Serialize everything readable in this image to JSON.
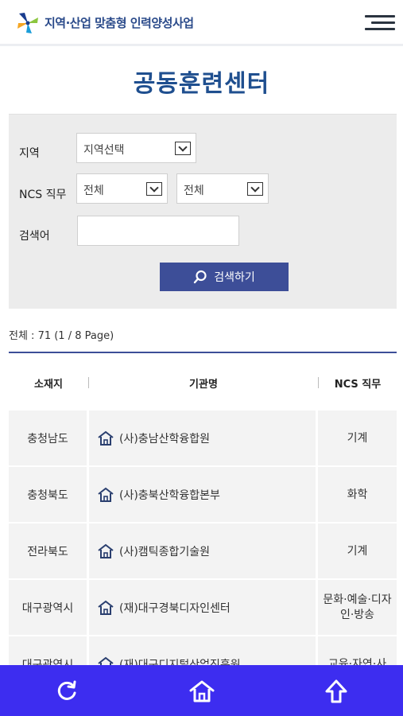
{
  "header": {
    "brand": "지역·산업 맞춤형 인력양성사업",
    "logo_icon": "pinwheel-logo-icon",
    "menu_icon": "hamburger-menu-icon"
  },
  "page_title": "공동훈련센터",
  "search": {
    "region_label": "지역",
    "region_value": "지역선택",
    "ncs_label": "NCS 직무",
    "ncs_value_1": "전체",
    "ncs_value_2": "전체",
    "keyword_label": "검색어",
    "keyword_value": "",
    "button_label": "검색하기",
    "button_icon": "search-icon"
  },
  "summary": "전체 : 71 (1 / 8 Page)",
  "table": {
    "headers": [
      "소재지",
      "기관명",
      "NCS 직무"
    ],
    "rows": [
      {
        "location": "충청남도",
        "name": "(사)충남산학융합원",
        "ncs": "기계"
      },
      {
        "location": "충청북도",
        "name": "(사)충북산학융합본부",
        "ncs": "화학"
      },
      {
        "location": "전라북도",
        "name": "(사)캠틱종합기술원",
        "ncs": "기계"
      },
      {
        "location": "대구광역시",
        "name": "(재)대구경북디자인센터",
        "ncs": "문화·예술·디자인·방송"
      },
      {
        "location": "대구광역시",
        "name": "(재)대구디지털산업진흥원",
        "ncs": "교육·자연·사"
      }
    ]
  },
  "bottom_bar": {
    "refresh_icon": "refresh-icon",
    "home_icon": "home-icon",
    "up_icon": "arrow-up-icon"
  },
  "colors": {
    "title": "#1f4f8f",
    "button": "#3d4e98",
    "bottom_bar": "#3d2df0",
    "panel": "#ececec"
  }
}
